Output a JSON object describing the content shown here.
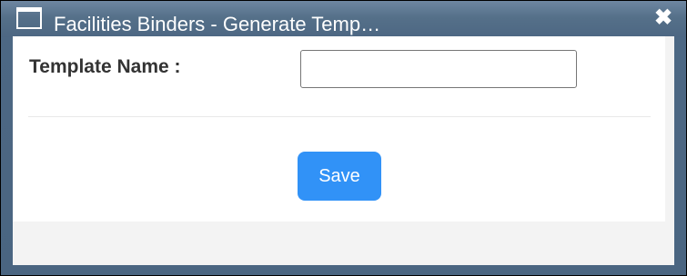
{
  "dialog": {
    "title": "Facilities Binders - Generate Temp…",
    "close_glyph": "✖",
    "icon": "window-icon"
  },
  "form": {
    "template_name_label": "Template Name :",
    "template_name_value": "",
    "template_name_placeholder": ""
  },
  "actions": {
    "save_label": "Save"
  },
  "colors": {
    "title_bar": "#557089",
    "save_button": "#3192f7",
    "label_text": "#333333",
    "body_background": "#f3f3f3"
  }
}
